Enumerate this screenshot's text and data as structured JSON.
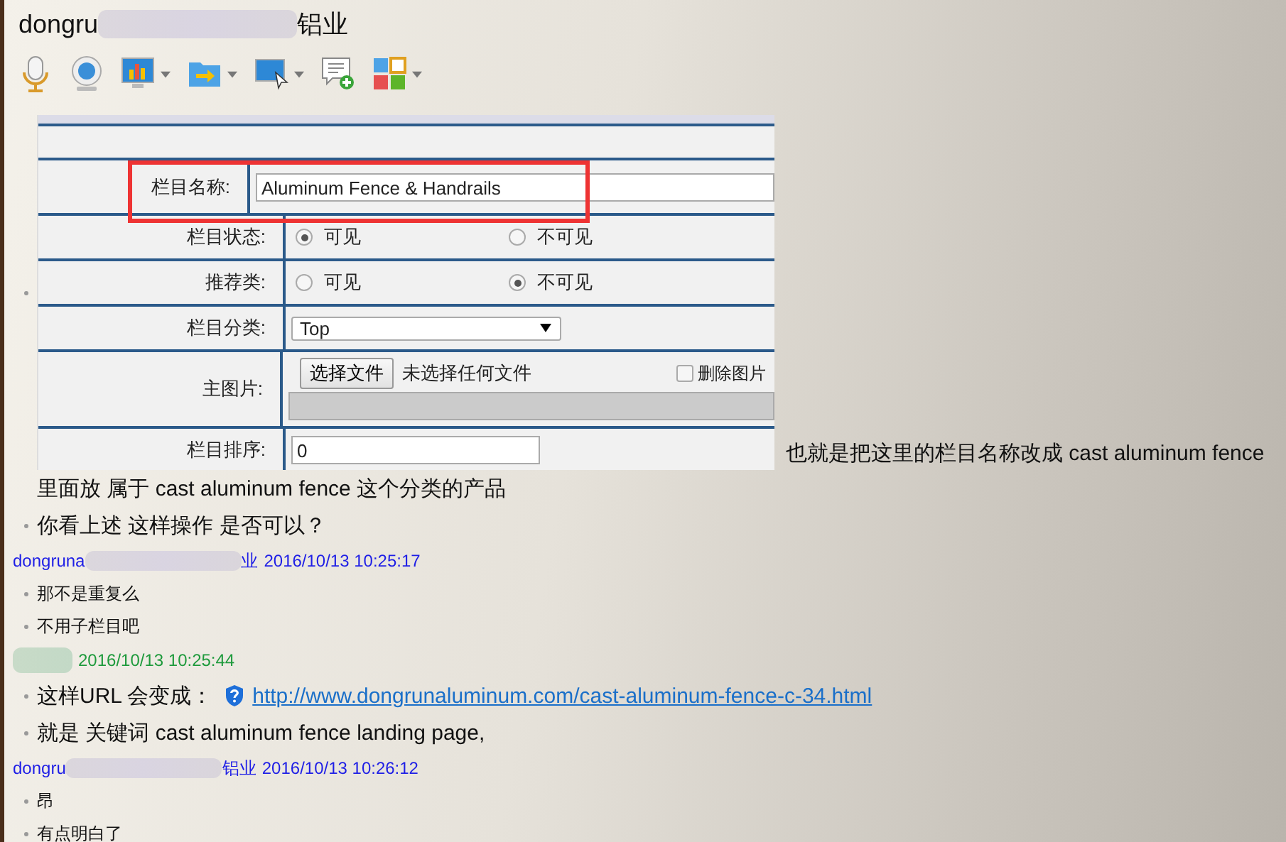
{
  "window": {
    "title_start": "dongru",
    "title_end": "铝业"
  },
  "toolbar": [
    {
      "kind": "mic",
      "dropdown": false
    },
    {
      "kind": "webcam",
      "dropdown": false
    },
    {
      "kind": "chart",
      "dropdown": true
    },
    {
      "kind": "folder",
      "dropdown": true
    },
    {
      "kind": "screen",
      "dropdown": true
    },
    {
      "kind": "message",
      "dropdown": false
    },
    {
      "kind": "apps",
      "dropdown": true
    }
  ],
  "embedded_form": {
    "rows": [
      {
        "kind": "text_input",
        "label": "栏目名称:",
        "value": "Aluminum Fence & Handrails",
        "highlighted": true
      },
      {
        "kind": "radio",
        "label": "栏目状态:",
        "options": [
          {
            "label": "可见",
            "selected": true
          },
          {
            "label": "不可见",
            "selected": false
          }
        ]
      },
      {
        "kind": "radio",
        "label": "推荐类:",
        "options": [
          {
            "label": "可见",
            "selected": false
          },
          {
            "label": "不可见",
            "selected": true
          }
        ]
      },
      {
        "kind": "select",
        "label": "栏目分类:",
        "value": "Top"
      },
      {
        "kind": "file",
        "label": "主图片:",
        "button": "选择文件",
        "status": "未选择任何文件",
        "delete_label": "删除图片",
        "delete_checked": false
      },
      {
        "kind": "text_input",
        "label": "栏目排序:",
        "value": "0",
        "highlighted": false
      }
    ]
  },
  "messages": [
    {
      "kind": "self",
      "lines": [
        {
          "kind": "image",
          "bullet": true,
          "text": "也就是把这里的栏目名称改成  cast aluminum fence"
        },
        {
          "kind": "text",
          "bullet": false,
          "text": "里面放 属于  cast aluminum fence 这个分类的产品"
        },
        {
          "kind": "text",
          "bullet": true,
          "text": "你看上述 这样操作 是否可以？"
        }
      ]
    },
    {
      "kind": "peer",
      "sender_start": "dongruna",
      "sender_end": "业",
      "time": "2016/10/13 10:25:17",
      "lines": [
        {
          "kind": "text",
          "bullet": true,
          "text": "那不是重复么"
        },
        {
          "kind": "text",
          "bullet": true,
          "text": "不用子栏目吧"
        }
      ]
    },
    {
      "kind": "self",
      "time": "2016/10/13 10:25:44",
      "lines": [
        {
          "kind": "text",
          "bullet": true,
          "text": "这样URL 会变成：",
          "link": "http://www.dongrunaluminum.com/cast-aluminum-fence-c-34.html"
        },
        {
          "kind": "text",
          "bullet": true,
          "text": "就是 关键词 cast aluminum fence  landing page,"
        }
      ]
    },
    {
      "kind": "peer",
      "sender_start": "dongru",
      "sender_end": "铝业",
      "time": "2016/10/13 10:26:12",
      "lines": [
        {
          "kind": "text",
          "bullet": true,
          "text": "昂"
        },
        {
          "kind": "text",
          "bullet": true,
          "text": "有点明白了"
        }
      ]
    }
  ]
}
